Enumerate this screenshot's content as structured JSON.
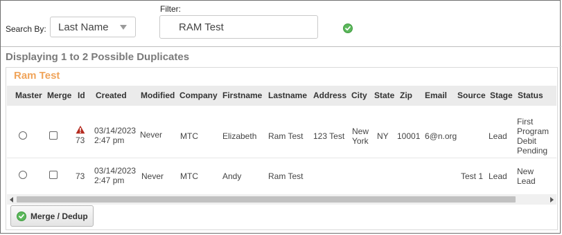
{
  "search_by": {
    "label": "Search By:",
    "selected": "Last Name"
  },
  "filter": {
    "label": "Filter:",
    "value": "RAM Test"
  },
  "results_heading": "Displaying 1 to 2 Possible Duplicates",
  "group": {
    "title": "Ram Test",
    "columns": [
      "Master",
      "Merge",
      "Id",
      "Created",
      "Modified",
      "Company",
      "Firstname",
      "Lastname",
      "Address",
      "City",
      "State",
      "Zip",
      "Email",
      "Source",
      "Stage",
      "Status"
    ],
    "rows": [
      {
        "id": "73",
        "warning": true,
        "created_date": "03/14/2023",
        "created_time": "2:47 pm",
        "modified": "Never",
        "company": "MTC",
        "firstname": "Elizabeth",
        "lastname": "Ram Test",
        "address": "123 Test",
        "city_line1": "New",
        "city_line2": "York",
        "state": "NY",
        "zip": "10001",
        "email": "6@n.org",
        "source": "",
        "stage": "Lead",
        "status_line1": "First",
        "status_line2": "Program",
        "status_line3": "Debit",
        "status_line4": "Pending"
      },
      {
        "id": "73",
        "warning": false,
        "created_date": "03/14/2023",
        "created_time": "2:47 pm",
        "modified": "Never",
        "company": "MTC",
        "firstname": "Andy",
        "lastname": "Ram Test",
        "address": "",
        "city_line1": "",
        "city_line2": "",
        "state": "",
        "zip": "",
        "email": "",
        "source": "Test 1",
        "stage": "Lead",
        "status_line1": "New",
        "status_line2": "Lead",
        "status_line3": "",
        "status_line4": ""
      }
    ]
  },
  "merge_button": {
    "label": "Merge / Dedup",
    "icon": "check-circle-icon"
  },
  "colors": {
    "accent_orange": "#f0a45a",
    "ok_green": "#5cb85c",
    "warning_red": "#b52b1f"
  }
}
